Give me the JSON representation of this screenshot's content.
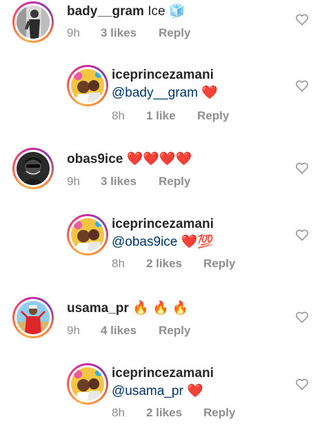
{
  "comments": [
    {
      "kind": "top",
      "username": "bady__gram",
      "text": "Ice ",
      "emoji": "🧊",
      "time": "9h",
      "likes": "3 likes",
      "reply": "Reply",
      "avatar": "bady-avatar"
    },
    {
      "kind": "reply",
      "username": "iceprincezamani",
      "mention": "@bady__gram",
      "hearts": "❤️",
      "extra": "",
      "time": "8h",
      "likes": "1 like",
      "reply": "Reply"
    },
    {
      "kind": "top",
      "username": "obas9ice",
      "text": "",
      "hearts": "❤️❤️❤️❤️",
      "time": "9h",
      "likes": "3 likes",
      "reply": "Reply"
    },
    {
      "kind": "reply",
      "username": "iceprincezamani",
      "mention": "@obas9ice",
      "hearts": "❤️",
      "extra": "💯",
      "time": "8h",
      "likes": "2 likes",
      "reply": "Reply"
    },
    {
      "kind": "top",
      "username": "usama_pr",
      "text": "",
      "fires": "🔥 🔥 🔥",
      "time": "9h",
      "likes": "4 likes",
      "reply": "Reply"
    },
    {
      "kind": "reply",
      "username": "iceprincezamani",
      "mention": "@usama_pr",
      "hearts": "❤️",
      "extra": "",
      "time": "8h",
      "likes": "2 likes",
      "reply": "Reply"
    }
  ],
  "icons": {
    "like": "heart-outline-icon"
  },
  "colors": {
    "mention": "#003569",
    "heart": "#e0162b",
    "meta": "#8e8e8e"
  }
}
